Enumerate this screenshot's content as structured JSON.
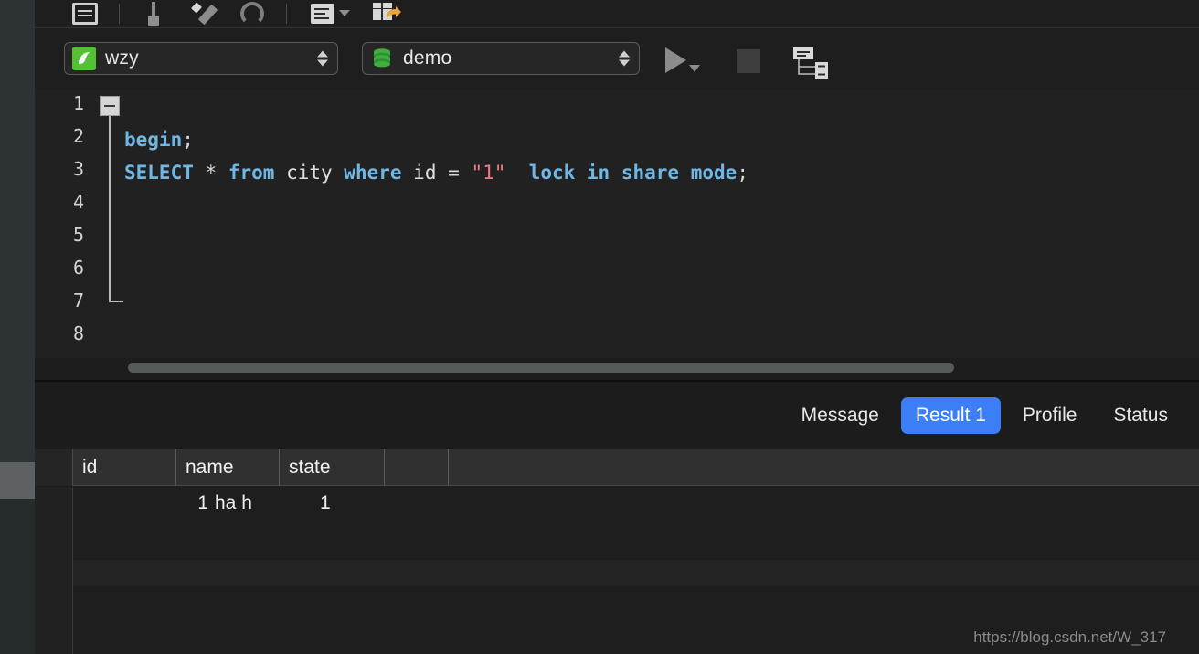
{
  "toolbar": {
    "icons": [
      {
        "name": "document-lines-icon",
        "label": "Document"
      },
      {
        "name": "pin-icon",
        "label": "Pin"
      },
      {
        "name": "wand-icon",
        "label": "Beautify"
      },
      {
        "name": "git-branch-icon",
        "label": "Version"
      },
      {
        "name": "list-dropdown-icon",
        "label": "Query list"
      },
      {
        "name": "grid-export-icon",
        "label": "Export result"
      }
    ]
  },
  "connection_bar": {
    "connection": {
      "value": "wzy",
      "icon": "mysql-dolphin-icon",
      "stepper_icon": "stepper-up-down-icon"
    },
    "database": {
      "value": "demo",
      "icon": "database-cylinder-icon",
      "stepper_icon": "stepper-up-down-icon"
    },
    "run_button": {
      "name": "run-icon",
      "label": "Run"
    },
    "run_dropdown": {
      "name": "chevron-down-icon",
      "label": "Run options"
    },
    "stop_button": {
      "name": "stop-icon",
      "label": "Stop"
    },
    "explain_button": {
      "name": "explain-plan-icon",
      "label": "Explain plan"
    }
  },
  "editor": {
    "line_numbers": [
      "1",
      "2",
      "3",
      "4",
      "5",
      "6",
      "7",
      "8"
    ],
    "fold_marker": "fold-collapse-icon",
    "lines": [
      {
        "number": "1",
        "tokens": [
          {
            "text": "begin",
            "type": "keyword"
          },
          {
            "text": ";",
            "type": "operator"
          }
        ]
      },
      {
        "number": "2",
        "tokens": [
          {
            "text": "SELECT",
            "type": "keyword"
          },
          {
            "text": " ",
            "type": "plain"
          },
          {
            "text": "*",
            "type": "operator"
          },
          {
            "text": " ",
            "type": "plain"
          },
          {
            "text": "from",
            "type": "keyword"
          },
          {
            "text": " ",
            "type": "plain"
          },
          {
            "text": "city",
            "type": "identifier"
          },
          {
            "text": " ",
            "type": "plain"
          },
          {
            "text": "where",
            "type": "keyword"
          },
          {
            "text": " ",
            "type": "plain"
          },
          {
            "text": "id",
            "type": "identifier"
          },
          {
            "text": " ",
            "type": "plain"
          },
          {
            "text": "=",
            "type": "operator"
          },
          {
            "text": " ",
            "type": "plain"
          },
          {
            "text": "\"1\"",
            "type": "string"
          },
          {
            "text": "  ",
            "type": "plain"
          },
          {
            "text": "lock",
            "type": "keyword"
          },
          {
            "text": " ",
            "type": "plain"
          },
          {
            "text": "in",
            "type": "keyword"
          },
          {
            "text": " ",
            "type": "plain"
          },
          {
            "text": "share",
            "type": "keyword"
          },
          {
            "text": " ",
            "type": "plain"
          },
          {
            "text": "mode",
            "type": "keyword"
          },
          {
            "text": ";",
            "type": "operator"
          }
        ]
      }
    ],
    "line1_text": "begin;",
    "line2_text": "SELECT * from city where id = \"1\"  lock in share mode;",
    "horizontal_scrollbar": "editor-hscrollbar"
  },
  "results": {
    "tabs": [
      {
        "label": "Message",
        "active": false
      },
      {
        "label": "Result 1",
        "active": true
      },
      {
        "label": "Profile",
        "active": false
      },
      {
        "label": "Status",
        "active": false
      }
    ],
    "active_tab_color": "#3b7ef5",
    "table": {
      "columns": [
        "id",
        "name",
        "state"
      ],
      "rows": [
        {
          "id": "1",
          "name": "ha h",
          "state": "1"
        }
      ]
    }
  },
  "watermark": "https://blog.csdn.net/W_317"
}
